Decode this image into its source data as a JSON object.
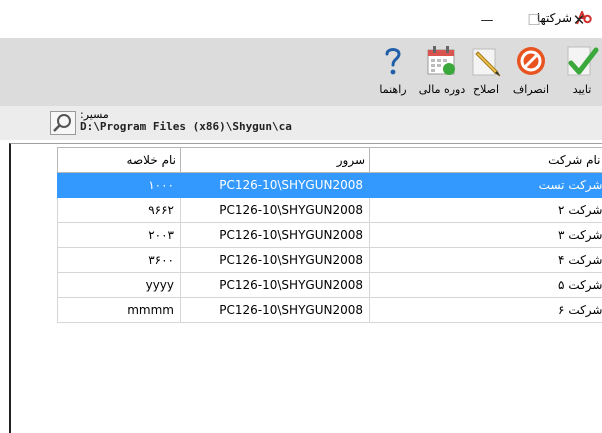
{
  "window": {
    "title": "شرکتها",
    "minimize_glyph": "—",
    "maximize_glyph": "☐",
    "close_glyph": "✕"
  },
  "toolbar": {
    "items": [
      {
        "label": "تایید",
        "icon": "checkmark-icon"
      },
      {
        "label": "انصراف",
        "icon": "cancel-icon"
      },
      {
        "label": "اصلاح",
        "icon": "pencil-icon"
      },
      {
        "label": "دوره مالی",
        "icon": "calendar-icon"
      },
      {
        "label": "راهنما",
        "icon": "help-icon"
      }
    ]
  },
  "path": {
    "label": "مسیر:",
    "value": "D:\\Program Files (x86)\\Shygun\\ca"
  },
  "table": {
    "headers": {
      "summary_name": "نام خلاصه",
      "server": "سرور",
      "company_name": "نام شرکت"
    },
    "rows": [
      {
        "summary_name": "۱۰۰۰",
        "server": "PC126-10\\SHYGUN2008",
        "company_name": "شرکت تست",
        "selected": true
      },
      {
        "summary_name": "۹۶۶۲",
        "server": "PC126-10\\SHYGUN2008",
        "company_name": "شرکت ۲"
      },
      {
        "summary_name": "۲۰۰۳",
        "server": "PC126-10\\SHYGUN2008",
        "company_name": "شرکت ۳"
      },
      {
        "summary_name": "۳۶۰۰",
        "server": "PC126-10\\SHYGUN2008",
        "company_name": "شرکت ۴"
      },
      {
        "summary_name": "yyyy",
        "server": "PC126-10\\SHYGUN2008",
        "company_name": "شرکت ۵"
      },
      {
        "summary_name": "mmmm",
        "server": "PC126-10\\SHYGUN2008",
        "company_name": "شرکت ۶"
      }
    ]
  },
  "colors": {
    "selection": "#3399ff",
    "toolbar_bg": "#dcdcdc",
    "logo": "#d0312d"
  }
}
